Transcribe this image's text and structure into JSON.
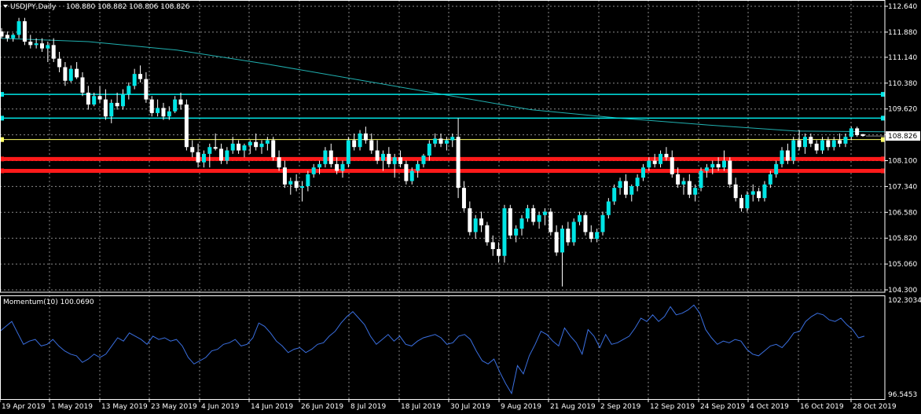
{
  "chart_data": {
    "type": "candlestick",
    "title": "USDJPY,Daily  108.880 108.882 108.806 108.826",
    "symbol": "USDJPY,Daily",
    "ohlc_header": "108.880 108.882 108.806 108.826",
    "ylim": [
      104.3,
      112.7
    ],
    "y_ticks": [
      "112.640",
      "111.880",
      "111.140",
      "110.380",
      "109.620",
      "108.860",
      "108.100",
      "107.340",
      "106.580",
      "105.820",
      "105.060",
      "104.300"
    ],
    "current_price": "108.826",
    "x_ticks": [
      "19 Apr 2019",
      "1 May 2019",
      "13 May 2019",
      "23 May 2019",
      "4 Jun 2019",
      "14 Jun 2019",
      "26 Jun 2019",
      "8 Jul 2019",
      "18 Jul 2019",
      "30 Jul 2019",
      "9 Aug 2019",
      "21 Aug 2019",
      "2 Sep 2019",
      "12 Sep 2019",
      "24 Sep 2019",
      "4 Oct 2019",
      "16 Oct 2019",
      "28 Oct 2019"
    ],
    "colors": {
      "bull": "#00e5e5",
      "bear": "#ffffff",
      "wick": "#ffffff",
      "ma": "#20b0b0",
      "cyan_level": "#00e5e5",
      "yellow_level": "#ffff66",
      "red_level": "#ff1a1a",
      "momentum": "#3a6fe0",
      "grid": "#8a8a8a",
      "axis_text": "#ffffff"
    },
    "horizontal_levels": [
      {
        "price": 110.05,
        "color": "#00e5e5"
      },
      {
        "price": 109.35,
        "color": "#00e5e5"
      },
      {
        "price": 108.72,
        "color": "#ffff66"
      },
      {
        "price": 108.15,
        "color": "#ff1a1a"
      },
      {
        "price": 107.8,
        "color": "#ff1a1a"
      }
    ],
    "moving_average": [
      111.7,
      111.6,
      111.35,
      110.95,
      110.5,
      110.05,
      109.6,
      109.35,
      109.15,
      108.97,
      108.95
    ],
    "candles": [
      [
        111.9,
        112.0,
        111.7,
        111.75
      ],
      [
        111.8,
        111.9,
        111.6,
        111.7
      ],
      [
        111.7,
        111.85,
        111.6,
        111.8
      ],
      [
        111.8,
        112.3,
        111.7,
        112.2
      ],
      [
        112.2,
        112.3,
        111.5,
        111.6
      ],
      [
        111.6,
        111.8,
        111.4,
        111.5
      ],
      [
        111.5,
        111.7,
        111.4,
        111.55
      ],
      [
        111.55,
        111.7,
        111.3,
        111.4
      ],
      [
        111.4,
        111.6,
        111.0,
        111.5
      ],
      [
        111.5,
        111.7,
        111.0,
        111.1
      ],
      [
        111.1,
        111.3,
        110.7,
        110.85
      ],
      [
        110.85,
        111.0,
        110.3,
        110.45
      ],
      [
        110.45,
        110.9,
        110.4,
        110.8
      ],
      [
        110.8,
        111.0,
        110.5,
        110.55
      ],
      [
        110.55,
        110.7,
        110.0,
        110.1
      ],
      [
        110.1,
        110.3,
        109.6,
        109.75
      ],
      [
        109.75,
        110.1,
        109.7,
        110.0
      ],
      [
        110.0,
        110.3,
        109.8,
        109.9
      ],
      [
        109.9,
        110.2,
        109.3,
        109.4
      ],
      [
        109.4,
        109.9,
        109.2,
        109.8
      ],
      [
        109.8,
        110.1,
        109.6,
        109.7
      ],
      [
        109.7,
        110.2,
        109.6,
        110.05
      ],
      [
        110.05,
        110.4,
        109.9,
        110.3
      ],
      [
        110.3,
        110.8,
        110.2,
        110.65
      ],
      [
        110.65,
        110.9,
        110.4,
        110.5
      ],
      [
        110.5,
        110.7,
        109.8,
        109.9
      ],
      [
        109.9,
        110.0,
        109.4,
        109.5
      ],
      [
        109.5,
        109.9,
        109.4,
        109.65
      ],
      [
        109.65,
        109.8,
        109.3,
        109.4
      ],
      [
        109.4,
        109.7,
        109.3,
        109.55
      ],
      [
        109.55,
        110.0,
        109.5,
        109.9
      ],
      [
        109.9,
        110.1,
        109.6,
        109.75
      ],
      [
        109.75,
        109.9,
        108.4,
        108.5
      ],
      [
        108.5,
        108.7,
        108.2,
        108.35
      ],
      [
        108.35,
        108.6,
        107.9,
        108.05
      ],
      [
        108.05,
        108.4,
        107.9,
        108.3
      ],
      [
        108.3,
        108.6,
        107.9,
        108.5
      ],
      [
        108.5,
        108.9,
        108.4,
        108.45
      ],
      [
        108.45,
        108.6,
        108.0,
        108.1
      ],
      [
        108.1,
        108.5,
        108.0,
        108.4
      ],
      [
        108.4,
        108.8,
        108.3,
        108.6
      ],
      [
        108.6,
        108.7,
        108.3,
        108.4
      ],
      [
        108.4,
        108.6,
        108.2,
        108.55
      ],
      [
        108.55,
        108.7,
        108.3,
        108.65
      ],
      [
        108.65,
        108.9,
        108.4,
        108.5
      ],
      [
        108.5,
        108.7,
        108.3,
        108.6
      ],
      [
        108.6,
        108.8,
        108.4,
        108.7
      ],
      [
        108.7,
        108.8,
        108.1,
        108.2
      ],
      [
        108.2,
        108.4,
        107.8,
        107.9
      ],
      [
        107.9,
        108.1,
        107.3,
        107.4
      ],
      [
        107.4,
        107.6,
        107.1,
        107.5
      ],
      [
        107.5,
        107.7,
        107.2,
        107.3
      ],
      [
        107.3,
        107.5,
        106.9,
        107.35
      ],
      [
        107.35,
        107.8,
        107.2,
        107.7
      ],
      [
        107.7,
        108.0,
        107.6,
        107.9
      ],
      [
        107.9,
        108.1,
        107.7,
        108.0
      ],
      [
        108.0,
        108.5,
        107.9,
        108.4
      ],
      [
        108.4,
        108.6,
        107.9,
        108.0
      ],
      [
        108.0,
        108.2,
        107.7,
        107.8
      ],
      [
        107.8,
        108.1,
        107.6,
        108.0
      ],
      [
        108.0,
        108.8,
        107.9,
        108.7
      ],
      [
        108.7,
        108.9,
        108.4,
        108.5
      ],
      [
        108.5,
        109.0,
        108.4,
        108.9
      ],
      [
        108.9,
        109.1,
        108.6,
        108.7
      ],
      [
        108.7,
        108.9,
        108.3,
        108.4
      ],
      [
        108.4,
        108.7,
        108.0,
        108.1
      ],
      [
        108.1,
        108.4,
        107.8,
        108.3
      ],
      [
        108.3,
        108.5,
        107.9,
        108.0
      ],
      [
        108.0,
        108.3,
        107.6,
        108.2
      ],
      [
        108.2,
        108.4,
        107.9,
        108.0
      ],
      [
        108.0,
        108.1,
        107.4,
        107.5
      ],
      [
        107.5,
        107.9,
        107.4,
        107.8
      ],
      [
        107.8,
        108.1,
        107.6,
        108.0
      ],
      [
        108.0,
        108.3,
        107.9,
        108.25
      ],
      [
        108.25,
        108.7,
        108.1,
        108.6
      ],
      [
        108.6,
        108.9,
        108.5,
        108.75
      ],
      [
        108.75,
        108.9,
        108.5,
        108.6
      ],
      [
        108.6,
        108.8,
        108.4,
        108.7
      ],
      [
        108.7,
        108.9,
        108.5,
        108.8
      ],
      [
        108.8,
        109.35,
        107.0,
        107.3
      ],
      [
        107.3,
        107.5,
        106.6,
        106.7
      ],
      [
        106.7,
        106.9,
        105.9,
        106.0
      ],
      [
        106.0,
        106.5,
        105.8,
        106.4
      ],
      [
        106.4,
        106.6,
        106.0,
        106.2
      ],
      [
        106.2,
        106.3,
        105.6,
        105.7
      ],
      [
        105.7,
        105.9,
        105.3,
        105.5
      ],
      [
        105.5,
        105.7,
        105.1,
        105.3
      ],
      [
        105.3,
        106.8,
        105.1,
        106.7
      ],
      [
        106.7,
        106.8,
        105.8,
        105.9
      ],
      [
        105.9,
        106.2,
        105.7,
        106.1
      ],
      [
        106.1,
        106.5,
        105.9,
        106.4
      ],
      [
        106.4,
        106.8,
        106.3,
        106.7
      ],
      [
        106.7,
        106.8,
        106.2,
        106.3
      ],
      [
        106.3,
        106.6,
        106.1,
        106.5
      ],
      [
        106.5,
        106.7,
        106.2,
        106.6
      ],
      [
        106.6,
        106.7,
        105.9,
        106.0
      ],
      [
        106.0,
        106.2,
        105.3,
        105.4
      ],
      [
        105.4,
        106.2,
        104.4,
        106.1
      ],
      [
        106.1,
        106.3,
        105.6,
        105.7
      ],
      [
        105.7,
        106.4,
        105.6,
        106.3
      ],
      [
        106.3,
        106.6,
        106.2,
        106.5
      ],
      [
        106.5,
        106.6,
        105.9,
        106.0
      ],
      [
        106.0,
        106.2,
        105.7,
        105.8
      ],
      [
        105.8,
        106.1,
        105.7,
        106.0
      ],
      [
        106.0,
        106.6,
        105.9,
        106.5
      ],
      [
        106.5,
        107.0,
        106.4,
        106.9
      ],
      [
        106.9,
        107.4,
        106.8,
        107.3
      ],
      [
        107.3,
        107.6,
        107.1,
        107.5
      ],
      [
        107.5,
        107.7,
        107.0,
        107.1
      ],
      [
        107.1,
        107.4,
        106.9,
        107.35
      ],
      [
        107.35,
        107.7,
        107.2,
        107.6
      ],
      [
        107.6,
        108.0,
        107.5,
        107.9
      ],
      [
        107.9,
        108.2,
        107.8,
        108.1
      ],
      [
        108.1,
        108.3,
        107.9,
        108.0
      ],
      [
        108.0,
        108.4,
        107.9,
        108.3
      ],
      [
        108.3,
        108.5,
        108.1,
        108.2
      ],
      [
        108.2,
        108.4,
        107.6,
        107.7
      ],
      [
        107.7,
        107.9,
        107.3,
        107.4
      ],
      [
        107.4,
        107.6,
        107.1,
        107.5
      ],
      [
        107.5,
        107.7,
        107.0,
        107.1
      ],
      [
        107.1,
        107.4,
        106.9,
        107.3
      ],
      [
        107.3,
        107.9,
        107.2,
        107.8
      ],
      [
        107.8,
        108.0,
        107.6,
        107.9
      ],
      [
        107.9,
        108.1,
        107.7,
        108.0
      ],
      [
        108.0,
        108.2,
        107.8,
        107.9
      ],
      [
        107.9,
        108.4,
        107.8,
        108.1
      ],
      [
        108.1,
        108.2,
        107.3,
        107.4
      ],
      [
        107.4,
        107.6,
        106.9,
        107.0
      ],
      [
        107.0,
        107.1,
        106.6,
        106.7
      ],
      [
        106.7,
        107.2,
        106.6,
        107.1
      ],
      [
        107.1,
        107.4,
        106.9,
        107.2
      ],
      [
        107.2,
        107.3,
        106.9,
        107.0
      ],
      [
        107.0,
        107.5,
        106.9,
        107.4
      ],
      [
        107.4,
        107.8,
        107.3,
        107.7
      ],
      [
        107.7,
        108.1,
        107.6,
        108.0
      ],
      [
        108.0,
        108.5,
        107.9,
        108.4
      ],
      [
        108.4,
        108.6,
        108.0,
        108.1
      ],
      [
        108.1,
        108.8,
        108.0,
        108.7
      ],
      [
        108.7,
        109.0,
        108.4,
        108.5
      ],
      [
        108.5,
        108.9,
        108.3,
        108.8
      ],
      [
        108.8,
        108.9,
        108.5,
        108.6
      ],
      [
        108.6,
        108.7,
        108.3,
        108.4
      ],
      [
        108.4,
        108.8,
        108.3,
        108.7
      ],
      [
        108.7,
        108.8,
        108.4,
        108.5
      ],
      [
        108.5,
        108.8,
        108.4,
        108.7
      ],
      [
        108.7,
        108.9,
        108.5,
        108.6
      ],
      [
        108.6,
        108.9,
        108.5,
        108.8
      ],
      [
        108.8,
        109.1,
        108.7,
        109.05
      ],
      [
        109.05,
        109.1,
        108.8,
        108.85
      ],
      [
        108.88,
        108.882,
        108.806,
        108.826
      ]
    ],
    "momentum": {
      "label": "Momentum(10) 100.0690",
      "ylim": [
        96.5453,
        102.3034
      ],
      "y_ticks": [
        "102.3034",
        "96.5453"
      ],
      "values": [
        100.4,
        100.7,
        101.0,
        100.3,
        99.6,
        99.8,
        99.9,
        99.5,
        99.6,
        99.9,
        99.5,
        99.2,
        99.0,
        98.9,
        98.5,
        98.7,
        99.0,
        98.8,
        99.0,
        99.5,
        100.0,
        99.8,
        100.3,
        100.1,
        99.9,
        99.6,
        100.1,
        99.9,
        100.0,
        99.8,
        99.9,
        99.5,
        98.8,
        98.4,
        98.6,
        98.8,
        99.2,
        99.3,
        99.6,
        99.7,
        99.9,
        99.5,
        99.6,
        100.0,
        100.9,
        100.7,
        100.3,
        99.8,
        99.5,
        99.1,
        99.3,
        99.4,
        99.1,
        99.3,
        99.6,
        99.7,
        100.1,
        100.4,
        100.9,
        101.3,
        101.6,
        101.2,
        100.8,
        100.1,
        99.6,
        99.9,
        100.2,
        99.8,
        100.1,
        99.6,
        99.5,
        99.8,
        100.0,
        100.1,
        100.2,
        100.0,
        99.6,
        99.7,
        100.1,
        100.2,
        99.9,
        99.2,
        98.6,
        98.4,
        98.7,
        97.9,
        97.2,
        96.6,
        98.3,
        97.8,
        98.9,
        99.6,
        100.4,
        100.2,
        99.8,
        99.5,
        100.6,
        100.1,
        99.7,
        99.0,
        100.5,
        100.1,
        99.4,
        100.2,
        99.6,
        99.7,
        99.9,
        100.1,
        100.6,
        101.2,
        101.0,
        101.4,
        101.0,
        101.3,
        101.9,
        101.4,
        101.5,
        101.7,
        102.0,
        101.5,
        100.5,
        100.0,
        99.6,
        99.8,
        99.7,
        99.9,
        99.8,
        99.3,
        99.0,
        98.9,
        99.2,
        99.5,
        99.6,
        99.4,
        99.8,
        100.3,
        100.4,
        101.0,
        101.3,
        101.5,
        101.4,
        101.1,
        101.0,
        101.2,
        100.8,
        100.5,
        100.0,
        100.1
      ]
    }
  }
}
